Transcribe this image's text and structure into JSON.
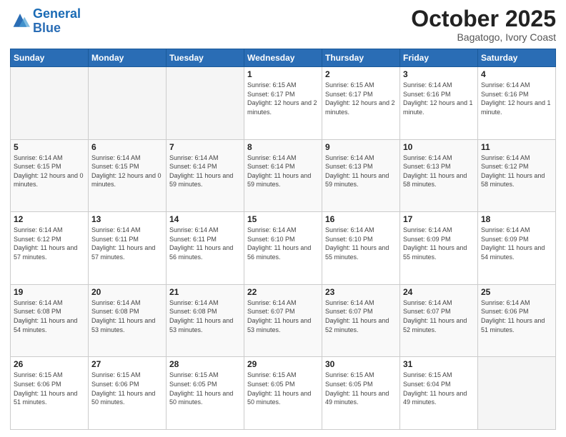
{
  "header": {
    "logo_line1": "General",
    "logo_line2": "Blue",
    "month": "October 2025",
    "location": "Bagatogo, Ivory Coast"
  },
  "days_of_week": [
    "Sunday",
    "Monday",
    "Tuesday",
    "Wednesday",
    "Thursday",
    "Friday",
    "Saturday"
  ],
  "weeks": [
    [
      {
        "day": "",
        "info": ""
      },
      {
        "day": "",
        "info": ""
      },
      {
        "day": "",
        "info": ""
      },
      {
        "day": "1",
        "info": "Sunrise: 6:15 AM\nSunset: 6:17 PM\nDaylight: 12 hours and 2 minutes."
      },
      {
        "day": "2",
        "info": "Sunrise: 6:15 AM\nSunset: 6:17 PM\nDaylight: 12 hours and 2 minutes."
      },
      {
        "day": "3",
        "info": "Sunrise: 6:14 AM\nSunset: 6:16 PM\nDaylight: 12 hours and 1 minute."
      },
      {
        "day": "4",
        "info": "Sunrise: 6:14 AM\nSunset: 6:16 PM\nDaylight: 12 hours and 1 minute."
      }
    ],
    [
      {
        "day": "5",
        "info": "Sunrise: 6:14 AM\nSunset: 6:15 PM\nDaylight: 12 hours and 0 minutes."
      },
      {
        "day": "6",
        "info": "Sunrise: 6:14 AM\nSunset: 6:15 PM\nDaylight: 12 hours and 0 minutes."
      },
      {
        "day": "7",
        "info": "Sunrise: 6:14 AM\nSunset: 6:14 PM\nDaylight: 11 hours and 59 minutes."
      },
      {
        "day": "8",
        "info": "Sunrise: 6:14 AM\nSunset: 6:14 PM\nDaylight: 11 hours and 59 minutes."
      },
      {
        "day": "9",
        "info": "Sunrise: 6:14 AM\nSunset: 6:13 PM\nDaylight: 11 hours and 59 minutes."
      },
      {
        "day": "10",
        "info": "Sunrise: 6:14 AM\nSunset: 6:13 PM\nDaylight: 11 hours and 58 minutes."
      },
      {
        "day": "11",
        "info": "Sunrise: 6:14 AM\nSunset: 6:12 PM\nDaylight: 11 hours and 58 minutes."
      }
    ],
    [
      {
        "day": "12",
        "info": "Sunrise: 6:14 AM\nSunset: 6:12 PM\nDaylight: 11 hours and 57 minutes."
      },
      {
        "day": "13",
        "info": "Sunrise: 6:14 AM\nSunset: 6:11 PM\nDaylight: 11 hours and 57 minutes."
      },
      {
        "day": "14",
        "info": "Sunrise: 6:14 AM\nSunset: 6:11 PM\nDaylight: 11 hours and 56 minutes."
      },
      {
        "day": "15",
        "info": "Sunrise: 6:14 AM\nSunset: 6:10 PM\nDaylight: 11 hours and 56 minutes."
      },
      {
        "day": "16",
        "info": "Sunrise: 6:14 AM\nSunset: 6:10 PM\nDaylight: 11 hours and 55 minutes."
      },
      {
        "day": "17",
        "info": "Sunrise: 6:14 AM\nSunset: 6:09 PM\nDaylight: 11 hours and 55 minutes."
      },
      {
        "day": "18",
        "info": "Sunrise: 6:14 AM\nSunset: 6:09 PM\nDaylight: 11 hours and 54 minutes."
      }
    ],
    [
      {
        "day": "19",
        "info": "Sunrise: 6:14 AM\nSunset: 6:08 PM\nDaylight: 11 hours and 54 minutes."
      },
      {
        "day": "20",
        "info": "Sunrise: 6:14 AM\nSunset: 6:08 PM\nDaylight: 11 hours and 53 minutes."
      },
      {
        "day": "21",
        "info": "Sunrise: 6:14 AM\nSunset: 6:08 PM\nDaylight: 11 hours and 53 minutes."
      },
      {
        "day": "22",
        "info": "Sunrise: 6:14 AM\nSunset: 6:07 PM\nDaylight: 11 hours and 53 minutes."
      },
      {
        "day": "23",
        "info": "Sunrise: 6:14 AM\nSunset: 6:07 PM\nDaylight: 11 hours and 52 minutes."
      },
      {
        "day": "24",
        "info": "Sunrise: 6:14 AM\nSunset: 6:07 PM\nDaylight: 11 hours and 52 minutes."
      },
      {
        "day": "25",
        "info": "Sunrise: 6:14 AM\nSunset: 6:06 PM\nDaylight: 11 hours and 51 minutes."
      }
    ],
    [
      {
        "day": "26",
        "info": "Sunrise: 6:15 AM\nSunset: 6:06 PM\nDaylight: 11 hours and 51 minutes."
      },
      {
        "day": "27",
        "info": "Sunrise: 6:15 AM\nSunset: 6:06 PM\nDaylight: 11 hours and 50 minutes."
      },
      {
        "day": "28",
        "info": "Sunrise: 6:15 AM\nSunset: 6:05 PM\nDaylight: 11 hours and 50 minutes."
      },
      {
        "day": "29",
        "info": "Sunrise: 6:15 AM\nSunset: 6:05 PM\nDaylight: 11 hours and 50 minutes."
      },
      {
        "day": "30",
        "info": "Sunrise: 6:15 AM\nSunset: 6:05 PM\nDaylight: 11 hours and 49 minutes."
      },
      {
        "day": "31",
        "info": "Sunrise: 6:15 AM\nSunset: 6:04 PM\nDaylight: 11 hours and 49 minutes."
      },
      {
        "day": "",
        "info": ""
      }
    ]
  ]
}
